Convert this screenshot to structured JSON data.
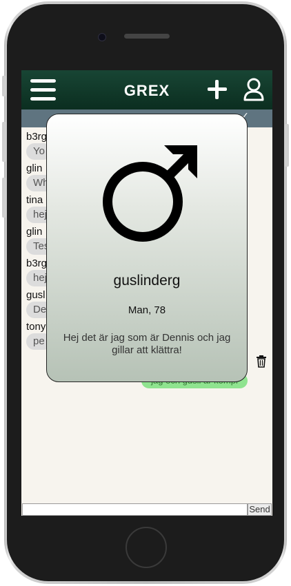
{
  "app": {
    "title": "GREX"
  },
  "chat": {
    "messages": [
      {
        "user": "b3rg",
        "text": "Yo"
      },
      {
        "user": "glin",
        "text": "Wh"
      },
      {
        "user": "tina",
        "text": "hej"
      },
      {
        "user": "glin",
        "text": "Tes"
      },
      {
        "user": "b3rg",
        "text": "hej"
      },
      {
        "user": "gusl",
        "text": "De"
      },
      {
        "user": "tony",
        "text": "pe"
      }
    ],
    "own_message": "jag och gusli är kompi"
  },
  "input": {
    "placeholder": "",
    "send_label": "Send"
  },
  "profile_popup": {
    "username": "guslinderg",
    "gender_age": "Man, 78",
    "bio": "Hej det är jag som är Dennis och jag gillar att klättra!"
  },
  "icons": {
    "menu": "hamburger-icon",
    "add": "plus-icon",
    "profile": "user-icon",
    "gender": "male-symbol-icon",
    "delete": "trash-icon"
  },
  "colors": {
    "appbar": "#0b2e20",
    "own_bubble": "#8fe38f",
    "subbar": "#5f7480"
  }
}
